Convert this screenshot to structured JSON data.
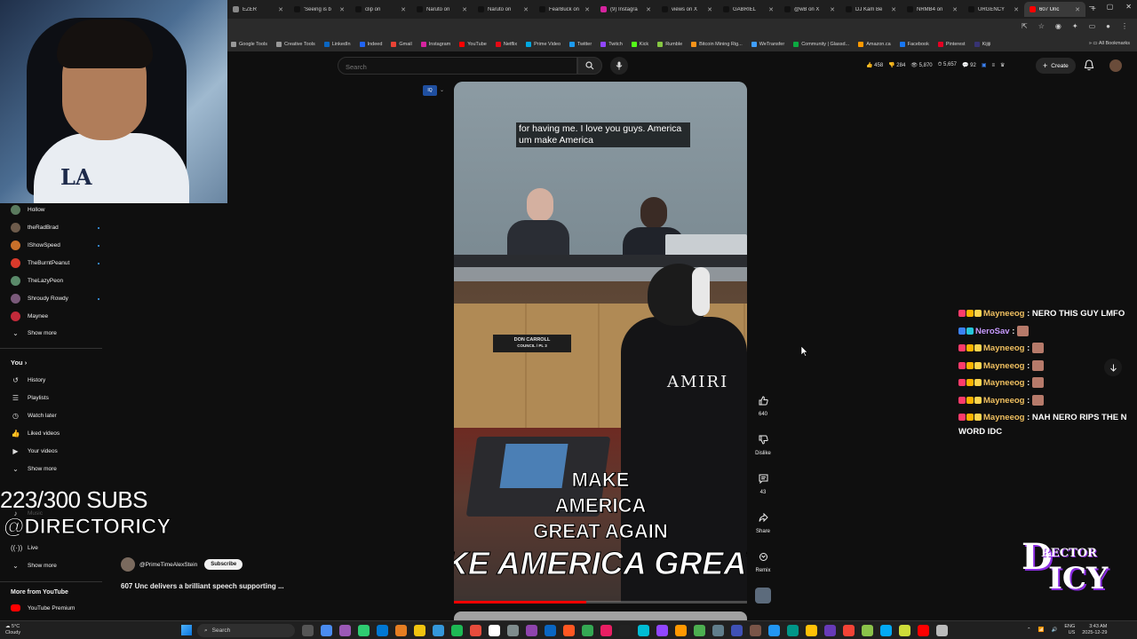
{
  "browser": {
    "tabs": [
      {
        "label": "EZER",
        "color": "#888888"
      },
      {
        "label": "'Seeing is b",
        "color": "#111111"
      },
      {
        "label": "clip on",
        "color": "#111111"
      },
      {
        "label": "Naruto on",
        "color": "#111111"
      },
      {
        "label": "Naruto on",
        "color": "#111111"
      },
      {
        "label": "FearBuck on",
        "color": "#111111"
      },
      {
        "label": "(9) Instagra",
        "color": "#d6249f"
      },
      {
        "label": "views on X",
        "color": "#111111"
      },
      {
        "label": "GABRIEL",
        "color": "#111111"
      },
      {
        "label": "@wB on X",
        "color": "#111111"
      },
      {
        "label": "DJ Kam Be",
        "color": "#111111"
      },
      {
        "label": "NRMB4 on",
        "color": "#111111"
      },
      {
        "label": "URGENCY",
        "color": "#111111"
      },
      {
        "label": "607 Unc",
        "color": "#ff0000",
        "active": true
      }
    ],
    "bookmarks": [
      {
        "label": "Google Tools",
        "color": "#999999"
      },
      {
        "label": "Creative Tools",
        "color": "#999999"
      },
      {
        "label": "LinkedIn",
        "color": "#0a66c2"
      },
      {
        "label": "Indeed",
        "color": "#2164f3"
      },
      {
        "label": "Gmail",
        "color": "#ea4335"
      },
      {
        "label": "Instagram",
        "color": "#d6249f"
      },
      {
        "label": "YouTube",
        "color": "#ff0000"
      },
      {
        "label": "Netflix",
        "color": "#e50914"
      },
      {
        "label": "Prime Video",
        "color": "#00a8e1"
      },
      {
        "label": "Twitter",
        "color": "#1d9bf0"
      },
      {
        "label": "Twitch",
        "color": "#9146ff"
      },
      {
        "label": "Kick",
        "color": "#53fc18"
      },
      {
        "label": "Rumble",
        "color": "#85c742"
      },
      {
        "label": "Bitcoin Mining Rig...",
        "color": "#f7931a"
      },
      {
        "label": "WeTransfer",
        "color": "#409fff"
      },
      {
        "label": "Community | Glassd...",
        "color": "#0caa41"
      },
      {
        "label": "Amazon.ca",
        "color": "#ff9900"
      },
      {
        "label": "Facebook",
        "color": "#1877f2"
      },
      {
        "label": "Pinterest",
        "color": "#e60023"
      },
      {
        "label": "Kijiji",
        "color": "#373373"
      }
    ],
    "all_bookmarks": "All Bookmarks"
  },
  "sidebar": {
    "subscriptions": [
      {
        "name": "Hollow",
        "color": "#5a7a5e",
        "live": false
      },
      {
        "name": "theRadBrad",
        "color": "#6d5b4b",
        "live": true
      },
      {
        "name": "IShowSpeed",
        "color": "#c8702a",
        "live": true
      },
      {
        "name": "TheBurntPeanut",
        "color": "#d93a2b",
        "live": true
      },
      {
        "name": "TheLazyPeon",
        "color": "#5a8a6a",
        "live": false
      },
      {
        "name": "Shroudy Rowdy",
        "color": "#7a5a7a",
        "live": true
      },
      {
        "name": "Maynee",
        "color": "#c22a3a",
        "live": false
      }
    ],
    "show_more": "Show more",
    "you_heading": "You",
    "you_items": [
      {
        "label": "History",
        "icon": "history-icon"
      },
      {
        "label": "Playlists",
        "icon": "playlists-icon"
      },
      {
        "label": "Watch later",
        "icon": "watch-later-icon"
      },
      {
        "label": "Liked videos",
        "icon": "liked-videos-icon"
      },
      {
        "label": "Your videos",
        "icon": "your-videos-icon"
      }
    ],
    "show_more_2": "Show more",
    "faded_items": [
      "Music"
    ],
    "live_label": "Live",
    "show_more_3": "Show more",
    "more_from": "More from YouTube",
    "premium": "YouTube Premium"
  },
  "overlay": {
    "subs": "223/300 SUBS",
    "handle": "@DIRECTORICY"
  },
  "topbar": {
    "search_placeholder": "Search",
    "stats": [
      "458",
      "284",
      "5,870",
      "5,657",
      "92"
    ],
    "create_label": "Create"
  },
  "video": {
    "caption_top": "for having me. I love you guys. America um make America",
    "nameplate_line1": "DON CARROLL",
    "nameplate_line2": "COUNCIL / PL 3",
    "shirt_text": "AMIRI",
    "caption_big_1": "MAKE",
    "caption_big_2": "AMERICA",
    "caption_big_3": "GREAT AGAIN",
    "caption_banner": "KE AMERICA GREAT AG",
    "progress_fraction": 0.45
  },
  "actions": {
    "like_count": "640",
    "dislike_label": "Dislike",
    "comment_count": "43",
    "share_label": "Share",
    "remix_label": "Remix"
  },
  "channel": {
    "handle": "@PrimeTimeAlexStein",
    "subscribe_label": "Subscribe",
    "title": "607 Unc delivers a brilliant speech supporting ..."
  },
  "chat": [
    {
      "user": "Mayneeog",
      "user_class": "may",
      "sep": " : ",
      "msg": "NERO THIS GUY LMFO",
      "emote": false
    },
    {
      "user": "NeroSav",
      "user_class": "nero",
      "sep": " : ",
      "msg": "",
      "emote": true
    },
    {
      "user": "Mayneeog",
      "user_class": "may",
      "sep": " : ",
      "msg": "",
      "emote": true
    },
    {
      "user": "Mayneeog",
      "user_class": "may",
      "sep": " : ",
      "msg": "",
      "emote": true
    },
    {
      "user": "Mayneeog",
      "user_class": "may",
      "sep": " : ",
      "msg": "",
      "emote": true
    },
    {
      "user": "Mayneeog",
      "user_class": "may",
      "sep": " : ",
      "msg": "",
      "emote": true
    },
    {
      "user": "Mayneeog",
      "user_class": "may",
      "sep": " : ",
      "msg": "NAH NERO RIPS THE N WORD IDC",
      "emote": false
    }
  ],
  "logo": {
    "top": "RECTOR",
    "big": "D",
    "icy": "ICY"
  },
  "webcam": {
    "shirt_logo": "LA"
  },
  "taskbar": {
    "weather_temp": "5°C",
    "weather_desc": "Cloudy",
    "search_label": "Search",
    "lang_1": "ENG",
    "lang_2": "US",
    "time": "3:43 AM",
    "date": "2025-12-29",
    "apps": [
      "#555555",
      "#4a8cf0",
      "#9b59b6",
      "#2ecc71",
      "#0078d4",
      "#e67e22",
      "#f1c40f",
      "#3498db",
      "#1db954",
      "#e74c3c",
      "#ffffff",
      "#7f8c8d",
      "#8e44ad",
      "#0a66c2",
      "#ff5722",
      "#34a853",
      "#e91e63",
      "#222222",
      "#00bcd4",
      "#9146ff",
      "#ff9800",
      "#4caf50",
      "#607d8b",
      "#3f51b5",
      "#795548",
      "#2196f3",
      "#009688",
      "#ffc107",
      "#673ab7",
      "#f44336",
      "#8bc34a",
      "#03a9f4",
      "#cddc39",
      "#ff0000",
      "#bbbbbb"
    ]
  }
}
